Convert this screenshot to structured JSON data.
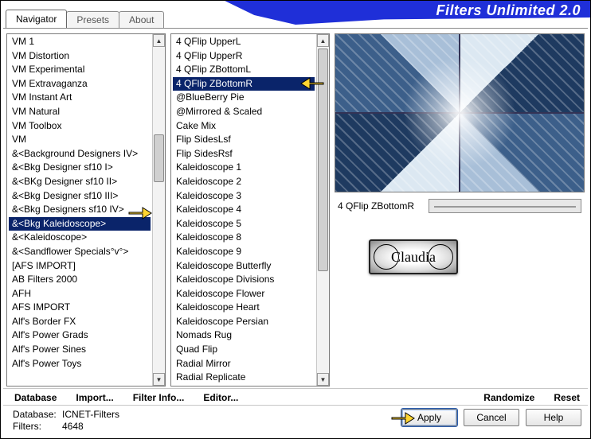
{
  "title": "Filters Unlimited 2.0",
  "tabs": [
    {
      "label": "Navigator",
      "active": true
    },
    {
      "label": "Presets",
      "active": false
    },
    {
      "label": "About",
      "active": false
    }
  ],
  "leftList": {
    "selectedIndex": 13,
    "items": [
      "VM 1",
      "VM Distortion",
      "VM Experimental",
      "VM Extravaganza",
      "VM Instant Art",
      "VM Natural",
      "VM Toolbox",
      "VM",
      "&<Background Designers IV>",
      "&<Bkg Designer sf10 I>",
      "&<BKg Designer sf10 II>",
      "&<Bkg Designer sf10 III>",
      "&<Bkg Designers sf10 IV>",
      "&<Bkg Kaleidoscope>",
      "&<Kaleidoscope>",
      "&<Sandflower Specials°v°>",
      "[AFS IMPORT]",
      "AB Filters 2000",
      "AFH",
      "AFS IMPORT",
      "Alf's Border FX",
      "Alf's Power Grads",
      "Alf's Power Sines",
      "Alf's Power Toys"
    ]
  },
  "midList": {
    "selectedIndex": 3,
    "items": [
      "4 QFlip UpperL",
      "4 QFlip UpperR",
      "4 QFlip ZBottomL",
      "4 QFlip ZBottomR",
      "@BlueBerry Pie",
      "@Mirrored & Scaled",
      "Cake Mix",
      "Flip SidesLsf",
      "Flip SidesRsf",
      "Kaleidoscope 1",
      "Kaleidoscope 2",
      "Kaleidoscope 3",
      "Kaleidoscope 4",
      "Kaleidoscope 5",
      "Kaleidoscope 8",
      "Kaleidoscope 9",
      "Kaleidoscope Butterfly",
      "Kaleidoscope Divisions",
      "Kaleidoscope Flower",
      "Kaleidoscope Heart",
      "Kaleidoscope Persian",
      "Nomads Rug",
      "Quad Flip",
      "Radial Mirror",
      "Radial Replicate"
    ]
  },
  "param": {
    "label": "4 QFlip ZBottomR"
  },
  "midbar": {
    "database": "Database",
    "import": "Import...",
    "filterinfo": "Filter Info...",
    "editor": "Editor...",
    "randomize": "Randomize",
    "reset": "Reset"
  },
  "status": {
    "db_label": "Database:",
    "db_value": "ICNET-Filters",
    "filters_label": "Filters:",
    "filters_value": "4648"
  },
  "buttons": {
    "apply": "Apply",
    "cancel": "Cancel",
    "help": "Help"
  },
  "stamp": "Claudia"
}
